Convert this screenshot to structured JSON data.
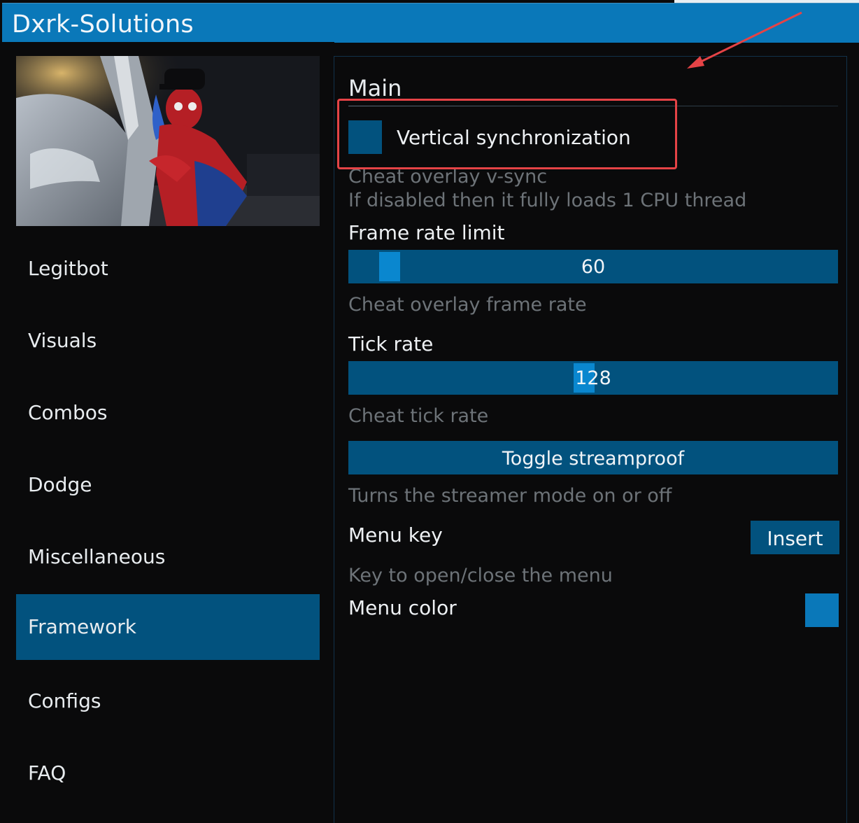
{
  "window": {
    "title": "Dxrk-Solutions"
  },
  "sidebar": {
    "items": [
      {
        "label": "Legitbot",
        "active": false
      },
      {
        "label": "Visuals",
        "active": false
      },
      {
        "label": "Combos",
        "active": false
      },
      {
        "label": "Dodge",
        "active": false
      },
      {
        "label": "Miscellaneous",
        "active": false
      },
      {
        "label": "Framework",
        "active": true
      },
      {
        "label": "Configs",
        "active": false
      },
      {
        "label": "FAQ",
        "active": false
      }
    ]
  },
  "main": {
    "section_title": "Main",
    "vsync": {
      "label": "Vertical synchronization",
      "checked": false,
      "desc_line1": "Cheat overlay v-sync",
      "desc_line2": "If disabled then it fully loads 1 CPU thread"
    },
    "frame_rate": {
      "label": "Frame rate limit",
      "value": "60",
      "fraction": 0.06,
      "desc": "Cheat overlay frame rate"
    },
    "tick_rate": {
      "label": "Tick rate",
      "value": "128",
      "fraction": 0.48,
      "desc": "Cheat tick rate"
    },
    "streamproof": {
      "button_label": "Toggle streamproof",
      "desc": "Turns the streamer mode on or off"
    },
    "menu_key": {
      "label": "Menu key",
      "key": "Insert",
      "desc": "Key to open/close the menu"
    },
    "menu_color": {
      "label": "Menu color",
      "color": "#0a78b9"
    }
  },
  "colors": {
    "accent": "#0a78b9",
    "widget": "#02527e",
    "annotation": "#e54346"
  }
}
